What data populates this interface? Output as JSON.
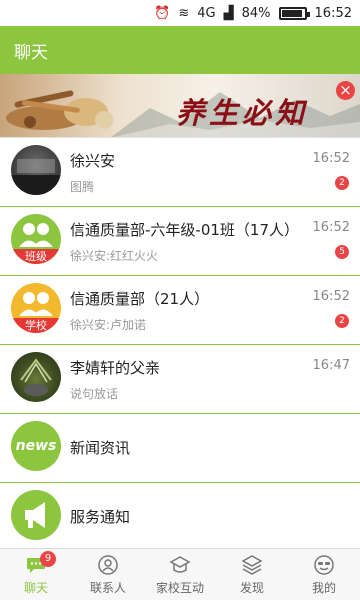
{
  "status_bar": {
    "network_label": "4G",
    "battery": "84%",
    "battery_level": 0.84,
    "time": "16:52"
  },
  "header": {
    "title": "聊天"
  },
  "banner": {
    "text": "养生必知",
    "close_icon": "×"
  },
  "conversations": [
    {
      "name": "徐兴安",
      "preview": "图腾",
      "time": "16:52",
      "unread": "2",
      "avatar": "photo"
    },
    {
      "name": "信通质量部-六年级-01班（17人）",
      "preview": "徐兴安:红红火火",
      "time": "16:52",
      "unread": "5",
      "avatar": "group",
      "avatar_tag": "班级"
    },
    {
      "name": "信通质量部（21人）",
      "preview": "徐兴安:卢加诺",
      "time": "16:52",
      "unread": "2",
      "avatar": "school",
      "avatar_tag": "学校"
    },
    {
      "name": "李婧轩的父亲",
      "preview": "说句放话",
      "time": "16:47",
      "avatar": "plant"
    },
    {
      "name": "新闻资讯",
      "avatar": "news",
      "avatar_text": "news"
    },
    {
      "name": "服务通知",
      "avatar": "notice"
    }
  ],
  "tabs": [
    {
      "label": "聊天",
      "icon": "chat-icon",
      "active": true,
      "badge": "9"
    },
    {
      "label": "联系人",
      "icon": "contacts-icon"
    },
    {
      "label": "家校互动",
      "icon": "school-icon"
    },
    {
      "label": "发现",
      "icon": "discover-icon"
    },
    {
      "label": "我的",
      "icon": "profile-icon"
    }
  ],
  "colors": {
    "brand": "#8cc63f",
    "badge": "#e94545",
    "school": "#f2b92c",
    "tag": "#e53935"
  }
}
